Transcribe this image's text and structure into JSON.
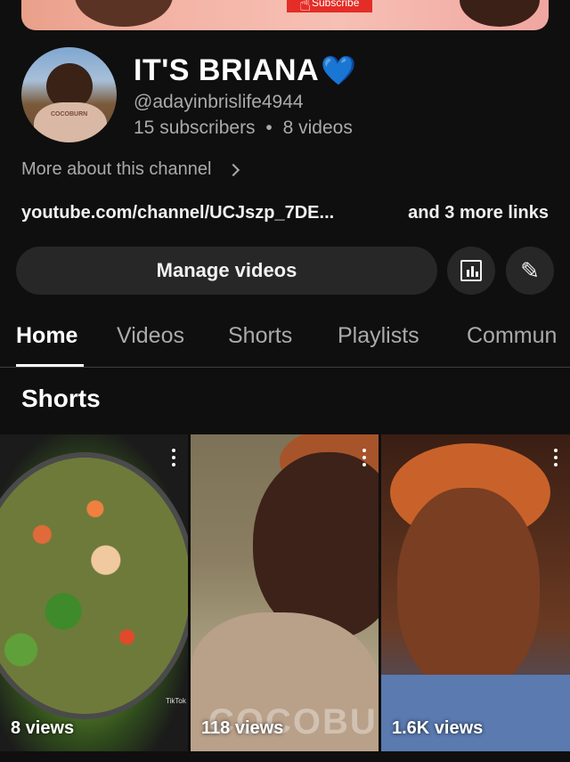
{
  "banner": {
    "subscribe_label": "Subscribe"
  },
  "avatar": {
    "shirt_text": "COCOBURN"
  },
  "channel": {
    "name": "IT'S BRIANA",
    "name_emoji": "💙",
    "handle": "@adayinbrislife4944",
    "subscribers": "15 subscribers",
    "separator": "•",
    "videos": "8 videos",
    "more_about": "More about this channel",
    "link": "youtube.com/channel/UCJszp_7DE...",
    "more_links": "and 3 more links"
  },
  "actions": {
    "manage_label": "Manage videos",
    "analytics_icon": "analytics-icon",
    "edit_icon": "pencil-icon"
  },
  "tabs": [
    {
      "label": "Home",
      "active": true
    },
    {
      "label": "Videos",
      "active": false
    },
    {
      "label": "Shorts",
      "active": false
    },
    {
      "label": "Playlists",
      "active": false
    },
    {
      "label": "Commun",
      "active": false
    }
  ],
  "section": {
    "title": "Shorts"
  },
  "shorts": [
    {
      "views": "8 views",
      "overlay": "TikTok"
    },
    {
      "views": "118 views",
      "overlay": "COCOBU"
    },
    {
      "views": "1.6K views",
      "overlay": ""
    }
  ],
  "colors": {
    "background": "#0f0f0f",
    "button_bg": "#272727",
    "secondary_text": "#aaaaaa",
    "subscribe_red": "#e52d27"
  }
}
